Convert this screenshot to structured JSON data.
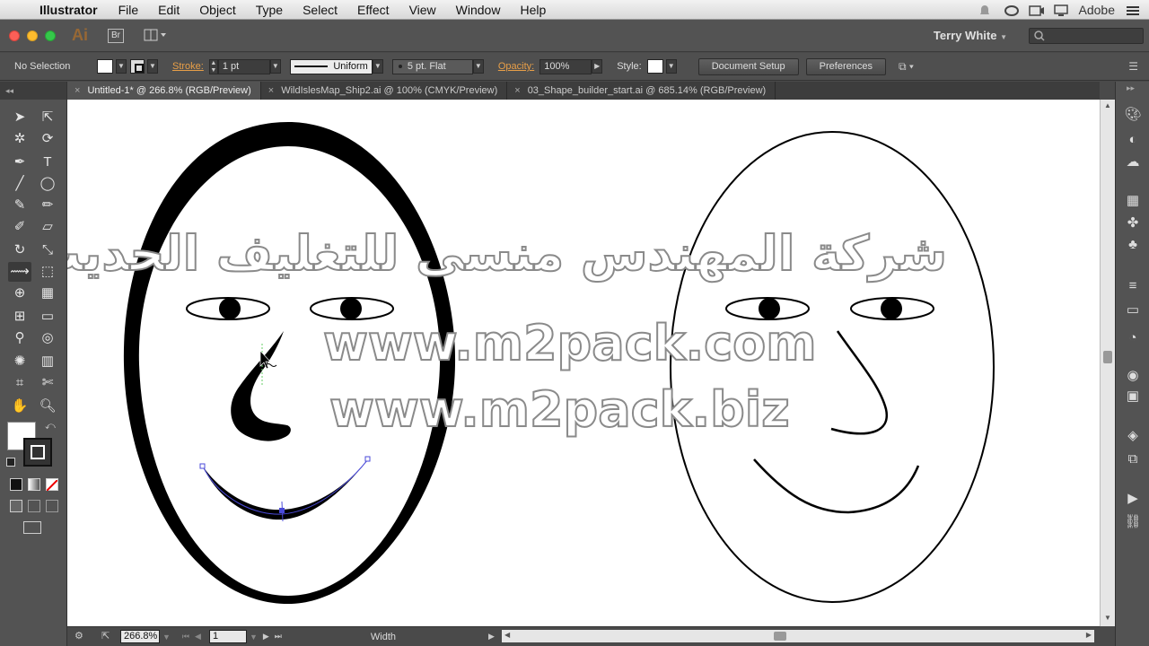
{
  "menubar": {
    "app_name": "Illustrator",
    "items": [
      "File",
      "Edit",
      "Object",
      "Type",
      "Select",
      "Effect",
      "View",
      "Window",
      "Help"
    ],
    "right_label": "Adobe"
  },
  "appbar": {
    "logo": "Ai",
    "bridge": "Br",
    "user": "Terry White"
  },
  "control": {
    "selection": "No Selection",
    "stroke_label": "Stroke:",
    "stroke_weight": "1 pt",
    "profile": "Uniform",
    "brush": "5 pt. Flat",
    "opacity_label": "Opacity:",
    "opacity": "100%",
    "style_label": "Style:",
    "document_setup": "Document Setup",
    "preferences": "Preferences"
  },
  "tabs": [
    {
      "label": "Untitled-1* @ 266.8% (RGB/Preview)",
      "active": true
    },
    {
      "label": "WildIslesMap_Ship2.ai @ 100% (CMYK/Preview)",
      "active": false
    },
    {
      "label": "03_Shape_builder_start.ai @ 685.14% (RGB/Preview)",
      "active": false
    }
  ],
  "status": {
    "zoom": "266.8%",
    "artboard": "1",
    "tool": "Width"
  },
  "watermark": {
    "arabic": "شركة المهندس منسى للتغليف الحديث",
    "url1": "www.m2pack.com",
    "url2": "www.m2pack.biz"
  },
  "icons": {
    "close": "close-icon",
    "apple": "apple-icon"
  },
  "colors": {
    "accent_orange": "#e89f48",
    "ui_dark": "#535353",
    "canvas": "#ffffff"
  }
}
